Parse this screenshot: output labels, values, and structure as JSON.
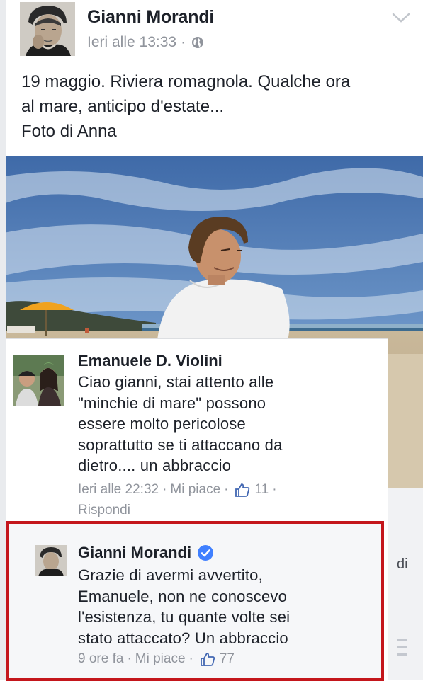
{
  "post": {
    "author": "Gianni Morandi",
    "time": "Ieri alle 13:33",
    "separator": "·",
    "text_lines": [
      "19 maggio. Riviera romagnola. Qualche ora",
      "al mare, anticipo d'estate...",
      "Foto di Anna"
    ]
  },
  "comment1": {
    "author": "Emanuele D. Violini",
    "text_lines": [
      "Ciao gianni, stai attento alle",
      "\"minchie di mare\" possono",
      "essere molto pericolose",
      "soprattutto se ti attaccano da",
      "dietro.... un abbraccio"
    ],
    "time": "Ieri alle 22:32",
    "like_label": "Mi piace",
    "likes": "11",
    "separator": "·",
    "reply_label": "Rispondi"
  },
  "comment2": {
    "author": "Gianni Morandi",
    "text_lines": [
      "Grazie di avermi avvertito,",
      "Emanuele, non ne conoscevo",
      "l'esistenza, tu quante volte sei",
      "stato attaccato? Un abbraccio"
    ],
    "time": "9 ore fa",
    "like_label": "Mi piace",
    "likes": "77",
    "separator": "·"
  },
  "side_card": {
    "text": "di"
  },
  "colors": {
    "highlight_border": "#c4161c",
    "verified_blue": "#4080ff",
    "meta_gray": "#90949c",
    "thumb_blue": "#4267b2"
  },
  "icons": [
    "globe-icon",
    "chevron-down-icon",
    "thumbs-up-icon",
    "verified-badge-icon"
  ]
}
